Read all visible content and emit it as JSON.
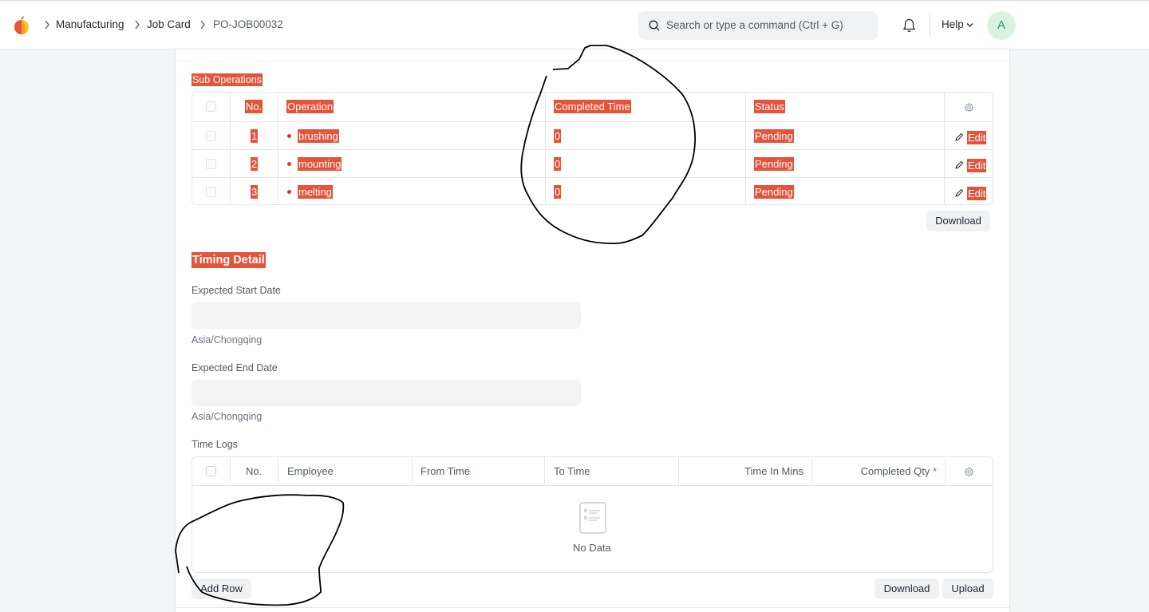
{
  "navbar": {
    "breadcrumbs": [
      "Manufacturing",
      "Job Card",
      "PO-JOB00032"
    ],
    "search_placeholder": "Search or type a command (Ctrl + G)",
    "help_label": "Help",
    "avatar_initial": "A"
  },
  "sub_operations": {
    "title": "Sub Operations",
    "columns": [
      "No.",
      "Operation",
      "Completed Time",
      "Status"
    ],
    "rows": [
      {
        "no": "1",
        "operation": "brushing",
        "completed_time": "0",
        "status": "Pending",
        "edit": "Edit"
      },
      {
        "no": "2",
        "operation": "mounting",
        "completed_time": "0",
        "status": "Pending",
        "edit": "Edit"
      },
      {
        "no": "3",
        "operation": "melting",
        "completed_time": "0",
        "status": "Pending",
        "edit": "Edit"
      }
    ],
    "download_label": "Download"
  },
  "timing": {
    "title": "Timing Detail",
    "expected_start_label": "Expected Start Date",
    "expected_start_value": "",
    "expected_start_tz": "Asia/Chongqing",
    "expected_end_label": "Expected End Date",
    "expected_end_value": "",
    "expected_end_tz": "Asia/Chongqing"
  },
  "time_logs": {
    "title": "Time Logs",
    "columns": {
      "no": "No.",
      "employee": "Employee",
      "from_time": "From Time",
      "to_time": "To Time",
      "time_in_mins": "Time In Mins",
      "completed_qty": "Completed Qty",
      "required_mark": "*"
    },
    "empty_text": "No Data",
    "add_row_label": "Add Row",
    "download_label": "Download",
    "upload_label": "Upload"
  },
  "colors": {
    "highlight": "#e5533b",
    "avatar_bg": "#d9f2e1",
    "avatar_fg": "#2e9b55"
  }
}
